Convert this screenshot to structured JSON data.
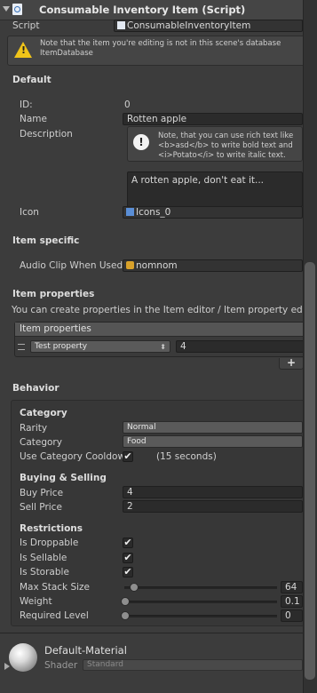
{
  "header": {
    "title": "Consumable Inventory Item (Script)"
  },
  "script_row": {
    "label": "Script",
    "value": "ConsumableInventoryItem"
  },
  "warning": {
    "line1": "Note that the item you're editing is not in this scene's database",
    "line2": "ItemDatabase"
  },
  "default": {
    "title": "Default",
    "id_label": "ID:",
    "id_value": "0",
    "name_label": "Name",
    "name_value": "Rotten apple",
    "description_label": "Description",
    "help_line1": "Note, that you can use rich text like",
    "help_line2": "<b>asd</b> to write bold text and",
    "help_line3": "<i>Potato</i> to write italic text.",
    "description_value": "A rotten apple, don't eat it...",
    "icon_label": "Icon",
    "icon_value": "Icons_0"
  },
  "item_specific": {
    "title": "Item specific",
    "audio_label": "Audio Clip When Used",
    "audio_value": "nomnom"
  },
  "item_properties": {
    "title": "Item properties",
    "description": "You can create properties in the Item editor / Item property ed",
    "list_header": "Item properties",
    "rows": [
      {
        "property": "Test property",
        "value": "4"
      }
    ],
    "add_label": "+"
  },
  "behavior": {
    "title": "Behavior",
    "category": {
      "title": "Category",
      "rarity_label": "Rarity",
      "rarity_value": "Normal",
      "category_label": "Category",
      "category_value": "Food",
      "cooldown_label": "Use Category Cooldow",
      "cooldown_checked": true,
      "cooldown_note": "(15 seconds)"
    },
    "buying": {
      "title": "Buying & Selling",
      "buy_label": "Buy Price",
      "buy_value": "4",
      "sell_label": "Sell Price",
      "sell_value": "2"
    },
    "restrictions": {
      "title": "Restrictions",
      "droppable_label": "Is Droppable",
      "droppable": true,
      "sellable_label": "Is Sellable",
      "sellable": true,
      "storable_label": "Is Storable",
      "storable": true,
      "stack_label": "Max Stack Size",
      "stack_value": "64",
      "weight_label": "Weight",
      "weight_value": "0.1",
      "level_label": "Required Level",
      "level_value": "0"
    }
  },
  "material": {
    "name": "Default-Material",
    "shader_label": "Shader",
    "shader_value": "Standard"
  },
  "checkmark": "✔",
  "dropdown_arrow": "▾",
  "colors": {
    "warning": "#f0c419",
    "background": "#3c3c3c",
    "audio_icon": "#d8a12a",
    "asset_icon": "#5a8ed6"
  }
}
